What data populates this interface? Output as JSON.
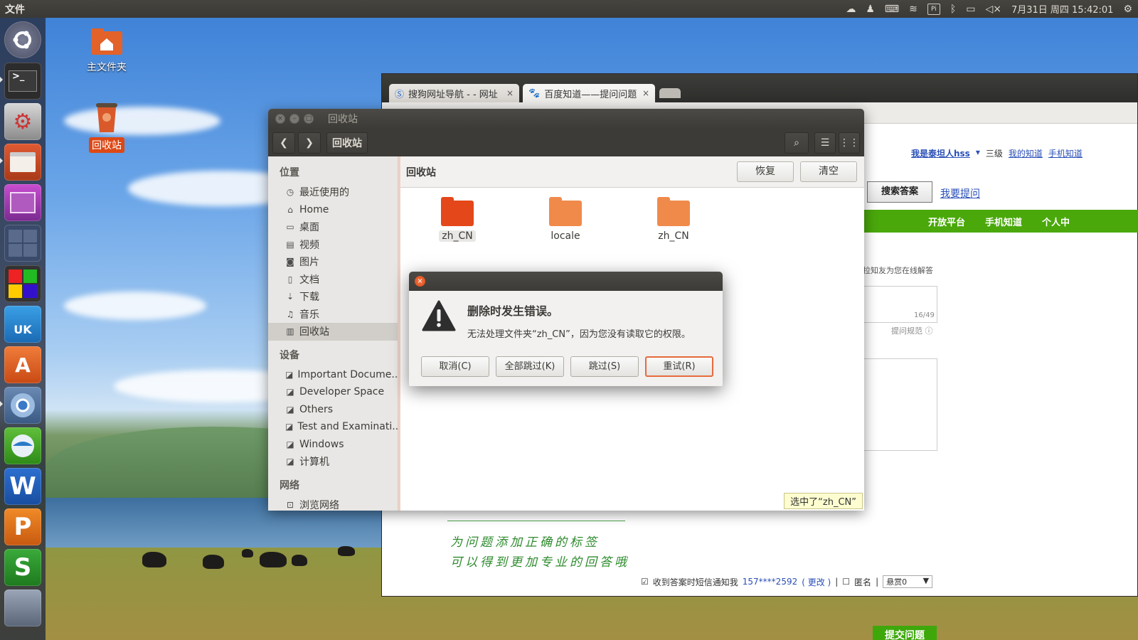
{
  "panel": {
    "app_title": "文件",
    "clock": "7月31日 周四 15:42:01",
    "pi_label": "Pi"
  },
  "desktop": {
    "home_label": "主文件夹",
    "trash_label": "回收站"
  },
  "launcher": {
    "items": [
      "ubuntu-dash",
      "terminal",
      "system-settings",
      "files",
      "workspace-app",
      "workspace-switcher",
      "color-app",
      "ubuntu-kylin-software",
      "software-center",
      "chromium",
      "kylin-assistant",
      "wps-writer",
      "wps-presentation",
      "wps-spreadsheets",
      "trash"
    ],
    "labels": {
      "uk": "UK",
      "writer": "W",
      "presentation": "P",
      "spreadsheets": "S",
      "software": "A"
    }
  },
  "browser": {
    "tabs": [
      {
        "label": "搜狗网址导航 - - 网址",
        "active": false
      },
      {
        "label": "百度知道——提问问题",
        "active": true
      }
    ],
    "user_link": "我是泰坦人hss",
    "level": "三级",
    "my_zhidao": "我的知道",
    "mobile_zhidao": "手机知道",
    "search_button": "搜索答案",
    "ask_link": "我要提问",
    "nav": [
      "开放平台",
      "手机知道",
      "个人中"
    ],
    "invite_text": "拉知友为您在线解答",
    "counter": "16/49",
    "spec_link": "提问规范",
    "handwriting": [
      "为问题添加正确的标签",
      "可以得到更加专业的回答哦"
    ],
    "sms_label": "收到答案时短信通知我",
    "phone": "157****2592",
    "change": "( 更改 )",
    "anonymous": "匿名",
    "reward": "悬赏0",
    "submit": "提交问题",
    "colors": {
      "green": "#4aa80b",
      "link": "#2a4fb8"
    }
  },
  "nautilus": {
    "window_title": "回收站",
    "path_button": "回收站",
    "sidebar": {
      "places_head": "位置",
      "places": [
        {
          "icon": "clock-icon",
          "glyph": "◷",
          "label": "最近使用的"
        },
        {
          "icon": "home-icon",
          "glyph": "⌂",
          "label": "Home"
        },
        {
          "icon": "desktop-folder-icon",
          "glyph": "▭",
          "label": "桌面"
        },
        {
          "icon": "video-icon",
          "glyph": "▤",
          "label": "视频"
        },
        {
          "icon": "camera-icon",
          "glyph": "◙",
          "label": "图片"
        },
        {
          "icon": "document-icon",
          "glyph": "▯",
          "label": "文档"
        },
        {
          "icon": "download-icon",
          "glyph": "⇣",
          "label": "下载"
        },
        {
          "icon": "music-icon",
          "glyph": "♫",
          "label": "音乐"
        },
        {
          "icon": "trash-icon",
          "glyph": "▥",
          "label": "回收站"
        }
      ],
      "devices_head": "设备",
      "devices": [
        {
          "icon": "drive-icon",
          "glyph": "◪",
          "label": "Important Docume..."
        },
        {
          "icon": "drive-icon",
          "glyph": "◪",
          "label": "Developer Space"
        },
        {
          "icon": "drive-icon",
          "glyph": "◪",
          "label": "Others"
        },
        {
          "icon": "drive-icon",
          "glyph": "◪",
          "label": "Test and Examinati..."
        },
        {
          "icon": "drive-icon",
          "glyph": "◪",
          "label": "Windows"
        },
        {
          "icon": "drive-icon",
          "glyph": "◪",
          "label": "计算机"
        }
      ],
      "network_head": "网络",
      "network": [
        {
          "icon": "network-icon",
          "glyph": "⊡",
          "label": "浏览网络"
        }
      ]
    },
    "location": "回收站",
    "restore_button": "恢复",
    "empty_button": "清空",
    "folders": [
      {
        "label": "zh_CN",
        "selected": true,
        "color": "#e4471a"
      },
      {
        "label": "locale",
        "selected": false,
        "color": "#f08a4b"
      },
      {
        "label": "zh_CN",
        "selected": false,
        "color": "#f08a4b"
      }
    ],
    "status": "选中了“zh_CN”"
  },
  "dialog": {
    "heading": "删除时发生错误。",
    "message": "无法处理文件夹“zh_CN”，因为您没有读取它的权限。",
    "buttons": {
      "cancel": "取消(C)",
      "skip_all": "全部跳过(K)",
      "skip": "跳过(S)",
      "retry": "重试(R)"
    }
  }
}
